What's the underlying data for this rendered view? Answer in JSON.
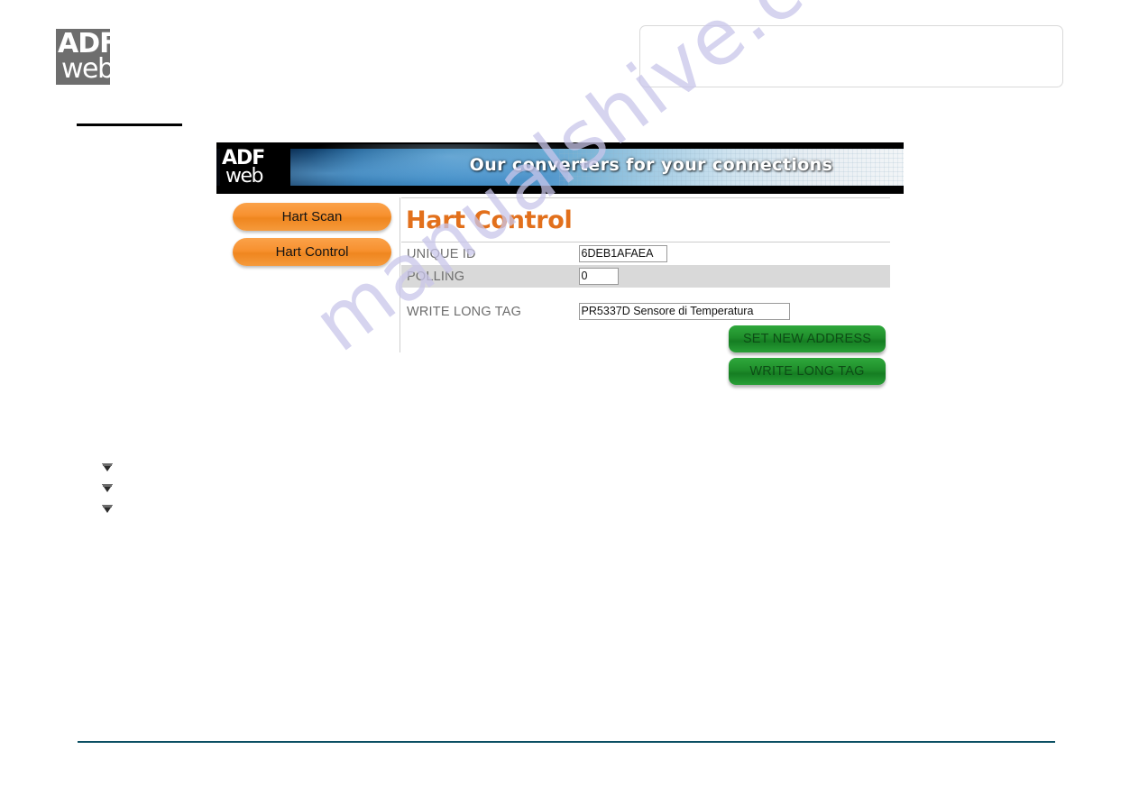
{
  "document": {
    "logo": {
      "line1": "ADF",
      "line2": "web"
    },
    "watermark": "manualshive.com"
  },
  "banner": {
    "logo": {
      "line1": "ADF",
      "line2": "web"
    },
    "slogan": "Our converters for your connections"
  },
  "nav": {
    "buttons": [
      {
        "label": "Hart Scan"
      },
      {
        "label": "Hart Control"
      }
    ]
  },
  "content": {
    "title": "Hart Control",
    "fields": [
      {
        "label": "UNIQUE ID",
        "value": "6DEB1AFAEA",
        "shaded": false
      },
      {
        "label": "POLLING",
        "value": "0",
        "shaded": true
      },
      {
        "label": "WRITE LONG TAG",
        "value": "PR5337D Sensore di Temperatura",
        "shaded": false
      }
    ],
    "actions": [
      {
        "label": "SET NEW ADDRESS"
      },
      {
        "label": "WRITE LONG TAG"
      }
    ]
  },
  "colors": {
    "title_orange": "#e2701c",
    "nav_button_orange": "#f7912f",
    "action_button_green": "#1f8e2b",
    "shaded_row_gray": "#d9d9d9",
    "footer_rule": "#0b4f63",
    "watermark": "#c9c6ea"
  }
}
